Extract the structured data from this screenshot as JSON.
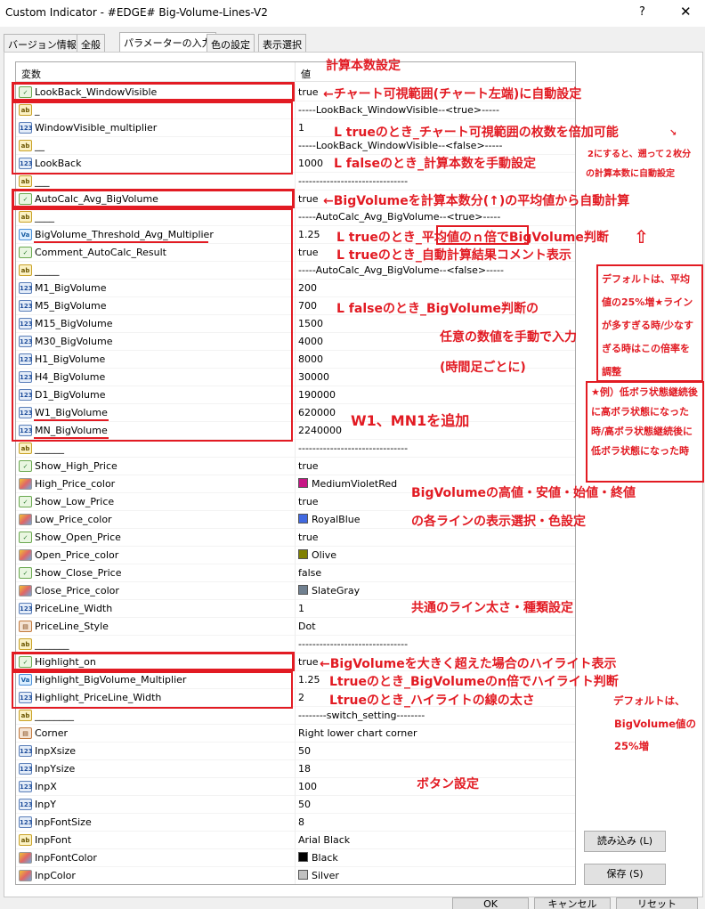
{
  "window": {
    "title": "Custom Indicator - #EDGE# Big-Volume-Lines-V2",
    "help_label": "?",
    "close_label": "✕"
  },
  "tabs": [
    {
      "label": "バージョン情報"
    },
    {
      "label": "全般"
    },
    {
      "label": "パラメーターの入力"
    },
    {
      "label": "色の設定"
    },
    {
      "label": "表示選択"
    }
  ],
  "grid": {
    "col_variable": "変数",
    "col_value": "値",
    "rows": [
      {
        "type": "bool",
        "name": "LookBack_WindowVisible",
        "value": "true"
      },
      {
        "type": "str",
        "name": "_",
        "value": "-----LookBack_WindowVisible--<true>-----"
      },
      {
        "type": "int",
        "name": "WindowVisible_multiplier",
        "value": "1"
      },
      {
        "type": "str",
        "name": "__",
        "value": "-----LookBack_WindowVisible--<false>-----"
      },
      {
        "type": "int",
        "name": "LookBack",
        "value": "1000"
      },
      {
        "type": "str",
        "name": "___",
        "value": "-------------------------------"
      },
      {
        "type": "bool",
        "name": "AutoCalc_Avg_BigVolume",
        "value": "true"
      },
      {
        "type": "str",
        "name": "____",
        "value": "-----AutoCalc_Avg_BigVolume--<true>-----"
      },
      {
        "type": "dbl",
        "name": "BigVolume_Threshold_Avg_Multiplier",
        "value": "1.25"
      },
      {
        "type": "bool",
        "name": "Comment_AutoCalc_Result",
        "value": "true"
      },
      {
        "type": "str",
        "name": "_____",
        "value": "-----AutoCalc_Avg_BigVolume--<false>-----"
      },
      {
        "type": "int",
        "name": "M1_BigVolume",
        "value": "200"
      },
      {
        "type": "int",
        "name": "M5_BigVolume",
        "value": "700"
      },
      {
        "type": "int",
        "name": "M15_BigVolume",
        "value": "1500"
      },
      {
        "type": "int",
        "name": "M30_BigVolume",
        "value": "4000"
      },
      {
        "type": "int",
        "name": "H1_BigVolume",
        "value": "8000"
      },
      {
        "type": "int",
        "name": "H4_BigVolume",
        "value": "30000"
      },
      {
        "type": "int",
        "name": "D1_BigVolume",
        "value": "190000"
      },
      {
        "type": "int",
        "name": "W1_BigVolume",
        "value": "620000"
      },
      {
        "type": "int",
        "name": "MN_BigVolume",
        "value": "2240000"
      },
      {
        "type": "str",
        "name": "______",
        "value": "-------------------------------"
      },
      {
        "type": "bool",
        "name": "Show_High_Price",
        "value": "true"
      },
      {
        "type": "color",
        "name": "High_Price_color",
        "value": "MediumVioletRed",
        "swatch": "#c71585"
      },
      {
        "type": "bool",
        "name": "Show_Low_Price",
        "value": "true"
      },
      {
        "type": "color",
        "name": "Low_Price_color",
        "value": "RoyalBlue",
        "swatch": "#4169e1"
      },
      {
        "type": "bool",
        "name": "Show_Open_Price",
        "value": "true"
      },
      {
        "type": "color",
        "name": "Open_Price_color",
        "value": "Olive",
        "swatch": "#808000"
      },
      {
        "type": "bool",
        "name": "Show_Close_Price",
        "value": "false"
      },
      {
        "type": "color",
        "name": "Close_Price_color",
        "value": "SlateGray",
        "swatch": "#708090"
      },
      {
        "type": "int",
        "name": "PriceLine_Width",
        "value": "1"
      },
      {
        "type": "enum",
        "name": "PriceLine_Style",
        "value": "Dot"
      },
      {
        "type": "str",
        "name": "_______",
        "value": "-------------------------------"
      },
      {
        "type": "bool",
        "name": "Highlight_on",
        "value": "true"
      },
      {
        "type": "dbl",
        "name": "Highlight_BigVolume_Multiplier",
        "value": "1.25"
      },
      {
        "type": "int",
        "name": "Highlight_PriceLine_Width",
        "value": "2"
      },
      {
        "type": "str",
        "name": "________",
        "value": "--------switch_setting--------"
      },
      {
        "type": "enum",
        "name": "Corner",
        "value": "Right lower chart corner"
      },
      {
        "type": "int",
        "name": "InpXsize",
        "value": "50"
      },
      {
        "type": "int",
        "name": "InpYsize",
        "value": "18"
      },
      {
        "type": "int",
        "name": "InpX",
        "value": "100"
      },
      {
        "type": "int",
        "name": "InpY",
        "value": "50"
      },
      {
        "type": "int",
        "name": "InpFontSize",
        "value": "8"
      },
      {
        "type": "str",
        "name": "InpFont",
        "value": "Arial Black"
      },
      {
        "type": "color",
        "name": "InpFontColor",
        "value": "Black",
        "swatch": "#000000"
      },
      {
        "type": "color",
        "name": "InpColor",
        "value": "Silver",
        "swatch": "#c0c0c0"
      }
    ]
  },
  "buttons": {
    "load": "読み込み (L)",
    "save": "保存 (S)",
    "ok": "OK",
    "cancel": "キャンセル",
    "reset": "リセット"
  },
  "annotations": {
    "calc_count": "計算本数設定",
    "lookback_visible": "←チャート可視範囲(チャート左端)に自動設定",
    "multiplier_true": "L trueのとき_チャート可視範囲の枚数を倍加可能",
    "side_note_1": "2にすると、遡って２枚分",
    "side_note_1_arrow": "↘",
    "side_note_2": "の計算本数に自動設定",
    "lookback_false": "L falseのとき_計算本数を手動設定",
    "autocalc": "←BigVolumeを計算本数分(↑)の平均値から自動計算",
    "threshold_true": "L trueのとき_平均値のｎ倍でBigVolume判断",
    "comment_true": "L trueのとき_自動計算結果コメント表示",
    "default_box_1": "デフォルトは、平均値の25%増★ラインが多すぎる時/少なすぎる時はこの倍率を調整",
    "manual_false": "L falseのとき_BigVolume判断の",
    "manual_any": "任意の数値を手動で入力",
    "manual_tf": "(時間足ごとに)",
    "example_box": "★例）低ボラ状態継続後に高ボラ状態になった時/高ボラ状態継続後に低ボラ状態になった時",
    "w1_mn1": "W1、MN1を追加",
    "lines_select_1": "BigVolumeの高値・安値・始値・終値",
    "lines_select_2": "の各ラインの表示選択・色設定",
    "common_line": "共通のライン太さ・種類設定",
    "highlight": "←BigVolumeを大きく超えた場合のハイライト表示",
    "highlight_mult": "Ltrueのとき_BigVolumeのn倍でハイライト判断",
    "highlight_width": "Ltrueのとき_ハイライトの線の太さ",
    "default_2a": "デフォルトは、",
    "default_2b": "BigVolume値の",
    "default_2c": "25%増",
    "button_setting": "ボタン設定",
    "up_arrow": "⇧"
  }
}
